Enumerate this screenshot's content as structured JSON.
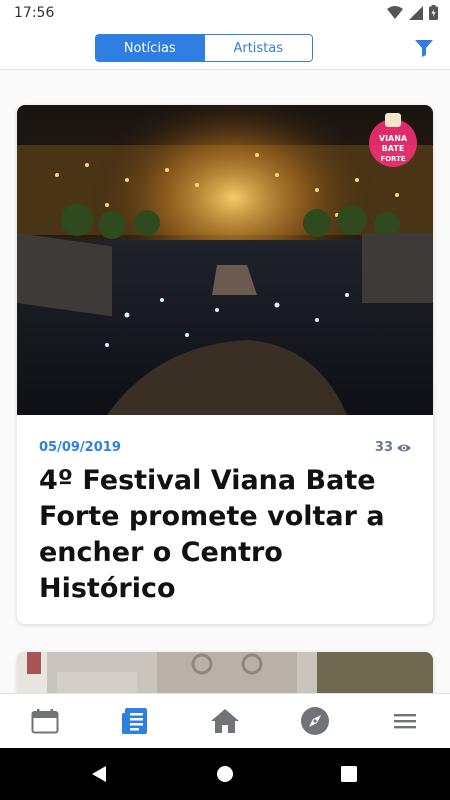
{
  "status_bar": {
    "time": "17:56"
  },
  "header": {
    "tabs": [
      {
        "label": "Notícias",
        "active": true
      },
      {
        "label": "Artistas",
        "active": false
      }
    ],
    "filter_icon": "filter-icon",
    "accent_color": "#2f7fe3"
  },
  "feed": {
    "cards": [
      {
        "date": "05/09/2019",
        "views": "33",
        "title": "4º Festival Viana Bate Forte promete voltar a encher o Centro Histórico",
        "image": "night aerial view of crowd in historic city square at festival",
        "logo_text": "VIANA BATE FORTE"
      },
      {
        "image": "historic stone building facade"
      }
    ]
  },
  "bottom_nav": {
    "items": [
      {
        "icon": "calendar-icon",
        "active": false
      },
      {
        "icon": "news-icon",
        "active": true
      },
      {
        "icon": "home-icon",
        "active": false
      },
      {
        "icon": "compass-icon",
        "active": false
      },
      {
        "icon": "menu-icon",
        "active": false
      }
    ]
  }
}
